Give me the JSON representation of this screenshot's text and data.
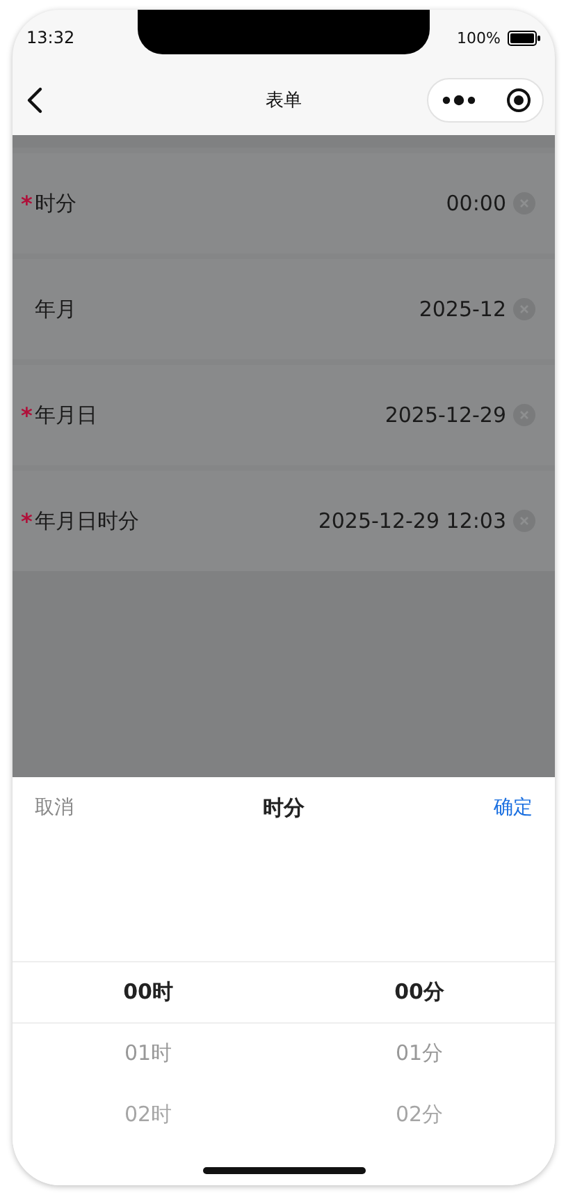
{
  "status_bar": {
    "time": "13:32",
    "battery": "100%"
  },
  "nav_bar": {
    "title": "表单"
  },
  "form": {
    "required_mark": "*",
    "rows": [
      {
        "label": "时分",
        "required": true,
        "value": "00:00"
      },
      {
        "label": "年月",
        "required": false,
        "value": "2025-12"
      },
      {
        "label": "年月日",
        "required": true,
        "value": "2025-12-29"
      },
      {
        "label": "年月日时分",
        "required": true,
        "value": "2025-12-29 12:03"
      }
    ]
  },
  "picker": {
    "cancel": "取消",
    "title": "时分",
    "confirm": "确定",
    "columns": [
      {
        "items": [
          {
            "label": "00时",
            "selected": true
          },
          {
            "label": "01时",
            "selected": false
          },
          {
            "label": "02时",
            "selected": false
          }
        ]
      },
      {
        "items": [
          {
            "label": "00分",
            "selected": true
          },
          {
            "label": "01分",
            "selected": false
          },
          {
            "label": "02分",
            "selected": false
          }
        ]
      }
    ]
  }
}
